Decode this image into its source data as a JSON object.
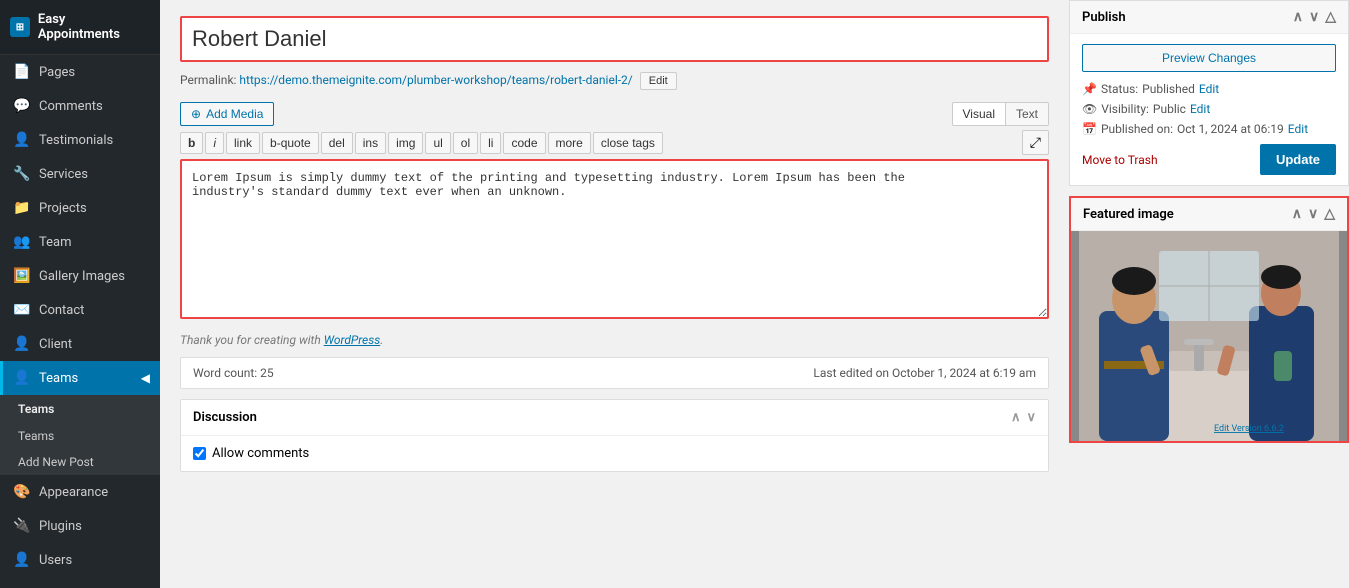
{
  "app": {
    "name": "Easy Appointments"
  },
  "sidebar": {
    "items": [
      {
        "id": "easy-appointments",
        "label": "Easy Appointments",
        "icon": "⊞"
      },
      {
        "id": "pages",
        "label": "Pages",
        "icon": "📄"
      },
      {
        "id": "comments",
        "label": "Comments",
        "icon": "💬"
      },
      {
        "id": "testimonials",
        "label": "Testimonials",
        "icon": "👤"
      },
      {
        "id": "services",
        "label": "Services",
        "icon": "🔧"
      },
      {
        "id": "projects",
        "label": "Projects",
        "icon": "📁"
      },
      {
        "id": "team",
        "label": "Team",
        "icon": "👥"
      },
      {
        "id": "gallery-images",
        "label": "Gallery Images",
        "icon": "🖼️"
      },
      {
        "id": "contact",
        "label": "Contact",
        "icon": "✉️"
      },
      {
        "id": "client",
        "label": "Client",
        "icon": "👤"
      },
      {
        "id": "teams",
        "label": "Teams",
        "icon": "👤",
        "active": true
      },
      {
        "id": "appearance",
        "label": "Appearance",
        "icon": "🎨"
      },
      {
        "id": "plugins",
        "label": "Plugins",
        "icon": "🔌"
      },
      {
        "id": "users",
        "label": "Users",
        "icon": "👤"
      }
    ],
    "submenu": {
      "header": "Teams",
      "items": [
        {
          "id": "teams-list",
          "label": "Teams"
        },
        {
          "id": "add-new-post",
          "label": "Add New Post"
        }
      ]
    }
  },
  "editor": {
    "title": "Robert Daniel",
    "permalink_label": "Permalink:",
    "permalink_url": "https://demo.themeignite.com/plumber-workshop/teams/robert-daniel-2/",
    "permalink_edit_label": "Edit",
    "add_media_label": "Add Media",
    "view_visual": "Visual",
    "view_text": "Text",
    "format_buttons": [
      "b",
      "i",
      "link",
      "b-quote",
      "del",
      "ins",
      "img",
      "ul",
      "ol",
      "li",
      "code",
      "more",
      "close tags"
    ],
    "content": "Lorem Ipsum is simply dummy text of the printing and typesetting industry. Lorem Ipsum has been the\nindustry's standard dummy text ever when an unknown.",
    "wp_credit": "Thank you for creating with",
    "wp_link_label": "WordPress",
    "word_count_label": "Word count: 25",
    "last_edited": "Last edited on October 1, 2024 at 6:19 am",
    "discussion_label": "Discussion",
    "allow_comments_label": "Allow comments"
  },
  "publish": {
    "title": "Publish",
    "preview_changes": "Preview Changes",
    "status_label": "Status:",
    "status_value": "Published",
    "status_edit": "Edit",
    "visibility_label": "Visibility:",
    "visibility_value": "Public",
    "visibility_edit": "Edit",
    "published_label": "Published on:",
    "published_date": "Oct 1, 2024 at 06:19",
    "published_edit": "Edit",
    "move_to_trash": "Move to Trash",
    "update_label": "Update"
  },
  "featured_image": {
    "title": "Featured image",
    "edit_version_link": "Edit Version 6.6.2"
  }
}
